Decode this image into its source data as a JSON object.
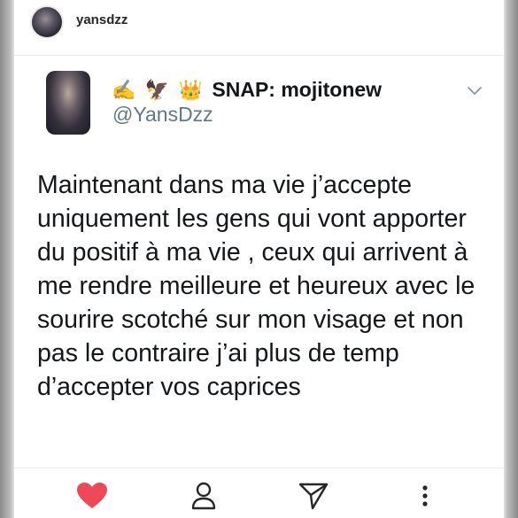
{
  "post": {
    "username": "yansdzz"
  },
  "tweet": {
    "emojis": [
      "✍",
      "🦅",
      "👑"
    ],
    "display_name": "SNAP: mojitonew",
    "handle": "@YansDzz",
    "text_lines": [
      "Maintenant dans ma vie j’accepte",
      "uniquement les gens qui vont apporter",
      "du positif à ma vie , ceux qui arrivent à",
      "me rendre meilleure et heureux avec le",
      "sourire scotché sur mon visage et non",
      "pas le contraire j’ai plus de temp",
      "d’accepter vos caprices"
    ]
  },
  "actions": {
    "icons": [
      "heart-icon",
      "profile-icon",
      "direct-send-icon",
      "more-vertical-icon"
    ]
  },
  "colors": {
    "like": "#ed4956",
    "icon": "#262626",
    "handle": "#657786",
    "text": "#14171a"
  }
}
